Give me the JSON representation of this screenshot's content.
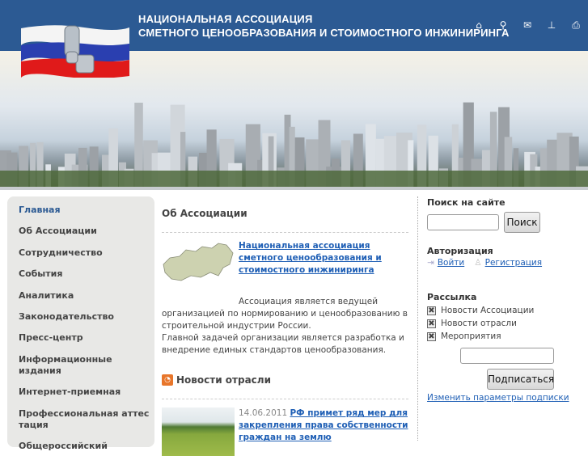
{
  "header": {
    "title_line1": "НАЦИОНАЛЬНАЯ АССОЦИАЦИЯ",
    "title_line2": "СМЕТНОГО ЦЕНООБРАЗОВАНИЯ И СТОИМОСТНОГО ИНЖИНИРИНГА",
    "icons": [
      {
        "name": "home-icon",
        "glyph": "⌂"
      },
      {
        "name": "search-icon",
        "glyph": "⚲"
      },
      {
        "name": "mail-icon",
        "glyph": "✉"
      },
      {
        "name": "sitemap-icon",
        "glyph": "⊥"
      },
      {
        "name": "print-icon",
        "glyph": "⎙"
      }
    ]
  },
  "nav": {
    "items": [
      "Главная",
      "Об Ассоциации",
      "Сотрудничество",
      "События",
      "Аналитика",
      "Законодательство",
      "Пресс-центр",
      "Информационные издания",
      "Интернет-приемная",
      "Профессиональная аттестация",
      "Общероссийский"
    ]
  },
  "about": {
    "heading": "Об Ассоциации",
    "link": "Национальная ассоциация сметного ценообразования и стоимостного инжиниринга",
    "text1": "Ассоциация является ведущей организацией по нормированию и ценообразованию в строительной индустрии России.",
    "text2": "Главной задачей организации является разработка и внедрение единых стандартов ценообразования."
  },
  "news": {
    "heading": "Новости отрасли",
    "items": [
      {
        "date": "14.06.2011",
        "title": "РФ примет ряд мер для закрепления права собственности граждан на землю"
      }
    ]
  },
  "search": {
    "heading": "Поиск на сайте",
    "value": "",
    "button": "Поиск"
  },
  "auth": {
    "heading": "Авторизация",
    "login": "Войти",
    "register": "Регистрация"
  },
  "subscribe": {
    "heading": "Рассылка",
    "options": [
      {
        "label": "Новости Ассоциации",
        "checked": true
      },
      {
        "label": "Новости отрасли",
        "checked": true
      },
      {
        "label": "Мероприятия",
        "checked": true
      }
    ],
    "email": "",
    "button": "Подписаться",
    "change_link": "Изменить параметры подписки"
  },
  "colors": {
    "header": "#2c5a93",
    "link": "#1f5fb5",
    "nav_bg": "#e8e8e6"
  }
}
